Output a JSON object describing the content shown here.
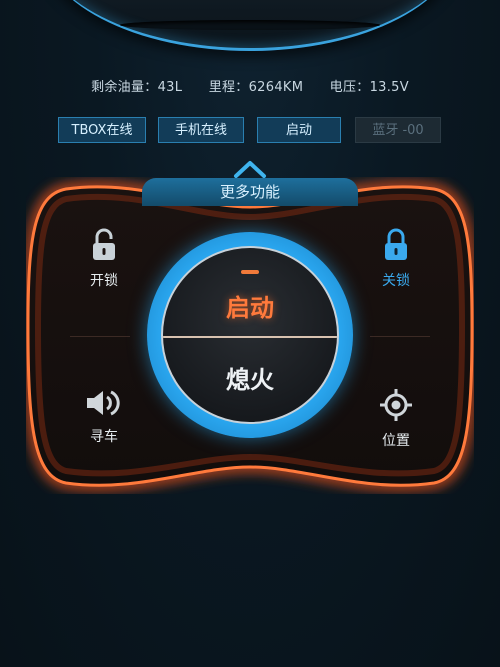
{
  "status": {
    "fuel": "剩余油量：43L",
    "mileage": "里程：6264KM",
    "voltage": "电压：13.5V"
  },
  "tags": [
    {
      "label": "TBOX在线",
      "enabled": true
    },
    {
      "label": "手机在线",
      "enabled": true
    },
    {
      "label": "启动",
      "enabled": true
    },
    {
      "label": "蓝牙 -00",
      "enabled": false
    }
  ],
  "more_functions_label": "更多功能",
  "controls": {
    "unlock": "开锁",
    "lock": "关锁",
    "find_car": "寻车",
    "location": "位置"
  },
  "knob": {
    "start": "启动",
    "stop": "熄火"
  },
  "colors": {
    "accent_blue": "#2aa7f0",
    "accent_orange": "#ff7a3c",
    "panel_glow": "#e4511c"
  },
  "icons": {
    "unlock": "unlocked-padlock-icon",
    "lock": "locked-padlock-icon",
    "find_car": "speaker-icon",
    "location": "crosshair-icon",
    "expand": "chevron-up-icon"
  }
}
